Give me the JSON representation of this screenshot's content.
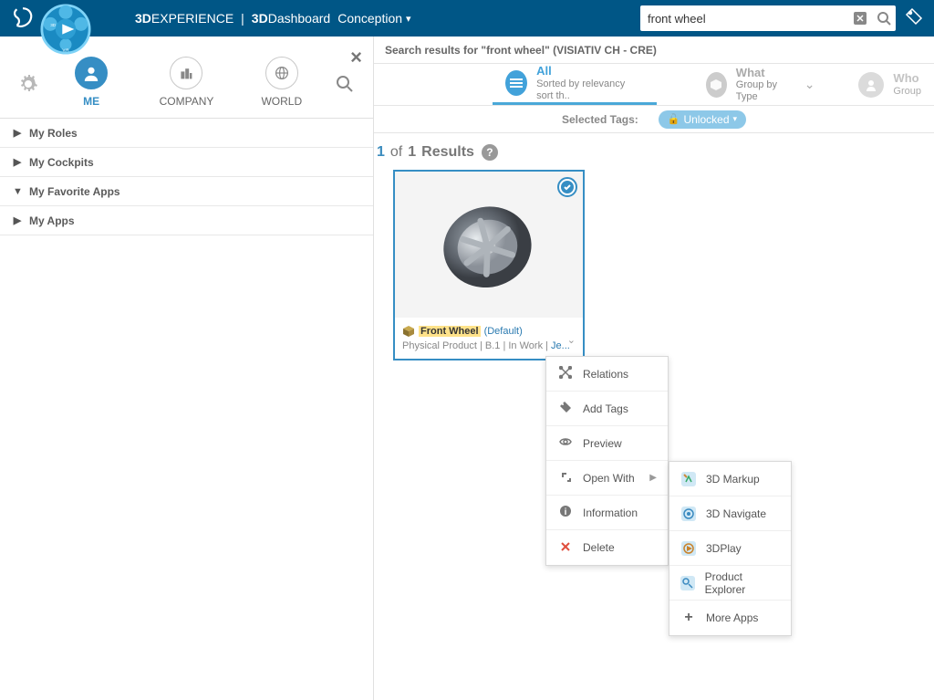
{
  "header": {
    "brand_bold1": "3D",
    "brand1": "EXPERIENCE",
    "brand_bold2": "3D",
    "brand2": "Dashboard",
    "context": "Conception",
    "search_value": "front wheel"
  },
  "left": {
    "tabs": [
      {
        "label": "ME"
      },
      {
        "label": "COMPANY"
      },
      {
        "label": "WORLD"
      }
    ],
    "nav": [
      {
        "label": "My Roles",
        "arrow": "▶"
      },
      {
        "label": "My Cockpits",
        "arrow": "▶"
      },
      {
        "label": "My Favorite Apps",
        "arrow": "▼"
      },
      {
        "label": "My Apps",
        "arrow": "▶"
      }
    ]
  },
  "results_header": "Search results for \"front wheel\" (VISIATIV CH - CRE)",
  "filters": {
    "all": {
      "title": "All",
      "sub": "Sorted by relevancy sort th.."
    },
    "what": {
      "title": "What",
      "sub": "Group by Type"
    },
    "who": {
      "title": "Who",
      "sub": "Group"
    }
  },
  "tags": {
    "label": "Selected Tags:",
    "unlocked": "Unlocked"
  },
  "count": {
    "n1": "1",
    "of": "of",
    "n2": "1",
    "word": "Results"
  },
  "card": {
    "name": "Front Wheel",
    "default": "(Default)",
    "meta_prefix": "Physical Product | B.1 | In Work | ",
    "meta_link": "Je..."
  },
  "menu": [
    {
      "icon": "✕",
      "label": "Relations"
    },
    {
      "icon": "🏷",
      "label": "Add Tags"
    },
    {
      "icon": "👁",
      "label": "Preview"
    },
    {
      "icon": "↘",
      "label": "Open With",
      "has_sub": true
    },
    {
      "icon": "ⓘ",
      "label": "Information"
    },
    {
      "icon": "✕",
      "label": "Delete",
      "danger": true
    }
  ],
  "submenu": [
    {
      "label": "3D Markup"
    },
    {
      "label": "3D Navigate"
    },
    {
      "label": "3DPlay"
    },
    {
      "label": "Product Explorer"
    },
    {
      "label": "More Apps",
      "plus": true
    }
  ]
}
